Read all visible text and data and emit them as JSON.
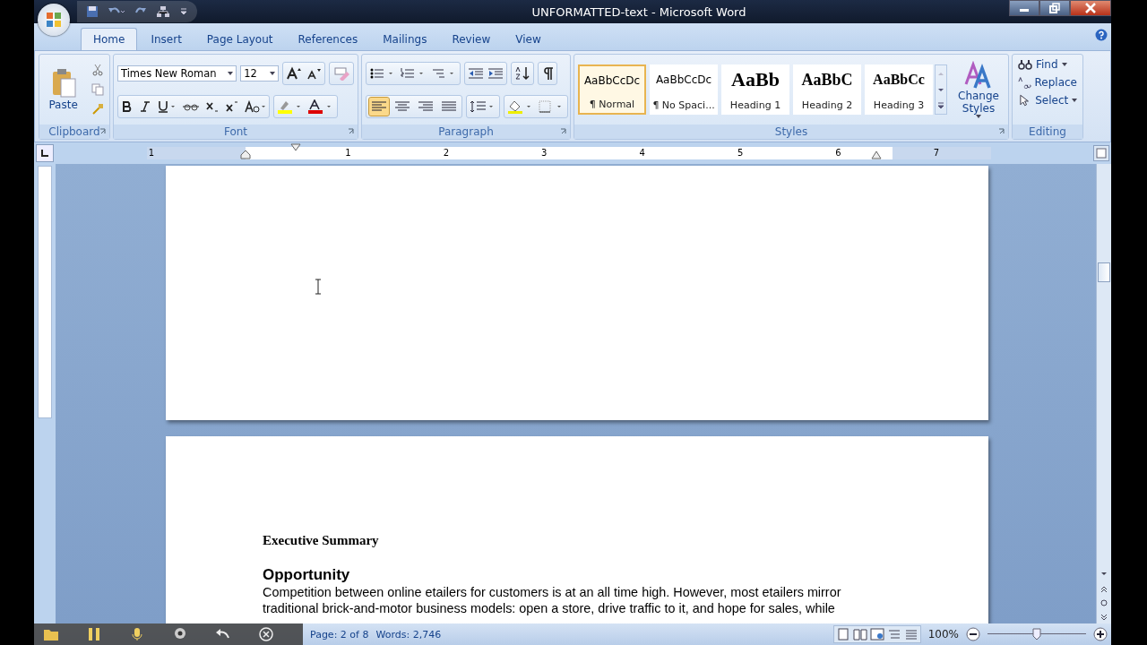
{
  "window": {
    "title": "UNFORMATTED-text - Microsoft Word"
  },
  "tabs": [
    {
      "label": "Home",
      "selected": true
    },
    {
      "label": "Insert",
      "selected": false
    },
    {
      "label": "Page Layout",
      "selected": false
    },
    {
      "label": "References",
      "selected": false
    },
    {
      "label": "Mailings",
      "selected": false
    },
    {
      "label": "Review",
      "selected": false
    },
    {
      "label": "View",
      "selected": false
    }
  ],
  "clipboard": {
    "paste": "Paste",
    "label": "Clipboard"
  },
  "font": {
    "name": "Times New Roman",
    "size": "12",
    "label": "Font"
  },
  "paragraph": {
    "label": "Paragraph",
    "alignment": [
      {
        "selected": true
      },
      {
        "selected": false
      },
      {
        "selected": false
      },
      {
        "selected": false
      }
    ]
  },
  "styles": {
    "label": "Styles",
    "gallery": [
      {
        "preview": "AaBbCcDc",
        "name": "¶ Normal",
        "kind": "normal",
        "selected": true
      },
      {
        "preview": "AaBbCcDc",
        "name": "¶ No Spaci...",
        "kind": "normal",
        "selected": false
      },
      {
        "preview": "AaBb",
        "name": "Heading 1",
        "kind": "h1",
        "selected": false
      },
      {
        "preview": "AaBbC",
        "name": "Heading 2",
        "kind": "h2",
        "selected": false
      },
      {
        "preview": "AaBbCc",
        "name": "Heading 3",
        "kind": "h3",
        "selected": false
      }
    ],
    "change_styles": "Change Styles"
  },
  "editing": {
    "label": "Editing",
    "items": [
      {
        "label": "Find",
        "kind": "find",
        "dropdown": true
      },
      {
        "label": "Replace",
        "kind": "replace",
        "dropdown": false
      },
      {
        "label": "Select",
        "kind": "select",
        "dropdown": true
      }
    ]
  },
  "ruler": {
    "numbers": [
      "1",
      "1",
      "2",
      "3",
      "4",
      "5",
      "6",
      "7"
    ]
  },
  "document": {
    "heading": "Executive Summary",
    "subheading": "Opportunity",
    "lines": [
      "Competition between online etailers for customers is at an all time high. However, most etailers mirror",
      "traditional brick-and-motor business models: open a store, drive traffic to it, and hope for sales, while"
    ]
  },
  "status_bar": {
    "page": "Page: 2 of 8",
    "words": "Words: 2,746",
    "zoom": "100%",
    "zoom_slider": {
      "level": 0.5
    }
  }
}
